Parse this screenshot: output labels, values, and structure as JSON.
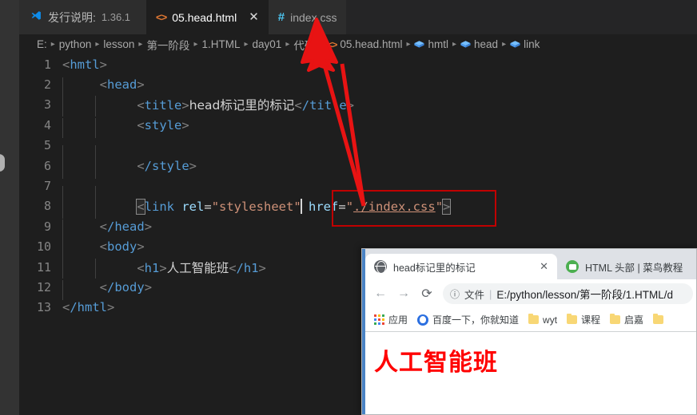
{
  "window": {
    "app": "Visual Studio Code",
    "tabs": [
      {
        "label": "发行说明:",
        "version": "1.36.1",
        "icon": "vscode-logo-icon",
        "state": "inactive",
        "closable": false
      },
      {
        "label": "05.head.html",
        "icon": "html-file-icon",
        "state": "active",
        "closable": true,
        "close_glyph": "✕"
      },
      {
        "label": "index.css",
        "icon": "css-file-icon",
        "state": "inactive",
        "closable": false
      }
    ]
  },
  "breadcrumb": {
    "separator": "▸",
    "items": [
      {
        "label": "E:",
        "icon": ""
      },
      {
        "label": "python",
        "icon": ""
      },
      {
        "label": "lesson",
        "icon": ""
      },
      {
        "label": "第一阶段",
        "icon": ""
      },
      {
        "label": "1.HTML",
        "icon": ""
      },
      {
        "label": "day01",
        "icon": ""
      },
      {
        "label": "代码",
        "icon": ""
      },
      {
        "label": "05.head.html",
        "icon": "html-file-icon"
      },
      {
        "label": "hmtl",
        "icon": "symbol-tag-icon"
      },
      {
        "label": "head",
        "icon": "symbol-tag-icon"
      },
      {
        "label": "link",
        "icon": "symbol-tag-icon"
      }
    ]
  },
  "editor": {
    "language": "html",
    "line_numbers": [
      1,
      2,
      3,
      4,
      5,
      6,
      7,
      8,
      9,
      10,
      11,
      12,
      13
    ],
    "lines": [
      {
        "n": 1,
        "text": "<hmtl>"
      },
      {
        "n": 2,
        "text": "    <head>"
      },
      {
        "n": 3,
        "text": "        <title>head标记里的标记</title>"
      },
      {
        "n": 4,
        "text": "        <style>"
      },
      {
        "n": 5,
        "text": ""
      },
      {
        "n": 6,
        "text": "        </style>"
      },
      {
        "n": 7,
        "text": ""
      },
      {
        "n": 8,
        "text": "        <link rel=\"stylesheet\" href=\"./index.css\">"
      },
      {
        "n": 9,
        "text": "    </head>"
      },
      {
        "n": 10,
        "text": "    <body>"
      },
      {
        "n": 11,
        "text": "        <h1>人工智能班</h1>"
      },
      {
        "n": 12,
        "text": "    </body>"
      },
      {
        "n": 13,
        "text": "</hmtl>"
      }
    ],
    "tokens": {
      "hmtl_open": "hmtl",
      "hmtl_close": "/hmtl",
      "head_open": "head",
      "head_close": "/head",
      "title_open": "title",
      "title_close": "/title",
      "title_text": "head标记里的标记",
      "style_open": "style",
      "style_close": "/style",
      "link_tag": "link",
      "attr_rel": "rel",
      "val_rel": "\"stylesheet\"",
      "attr_href": "href",
      "val_href_open": "\"",
      "val_href": "./index.css",
      "val_href_close": "\"",
      "body_open": "body",
      "body_close": "/body",
      "h1_open": "h1",
      "h1_close": "/h1",
      "h1_text": "人工智能班",
      "lt": "<",
      "gt": ">",
      "eq": "="
    },
    "colors": {
      "background": "#1e1e1e",
      "tag": "#569cd6",
      "attribute": "#9cdcfe",
      "string": "#ce9178",
      "plain": "#d4d4d4",
      "line_number": "#858585",
      "punctuation": "#808080"
    }
  },
  "annotation": {
    "type": "red-highlight-arrow",
    "color": "#c00000",
    "box_target": "href=\"./index.css\"",
    "arrow_points_to": "index.css"
  },
  "browser": {
    "tabs": [
      {
        "title": "head标记里的标记",
        "favicon": "globe-icon",
        "active": true,
        "close_glyph": "✕"
      },
      {
        "title": "HTML 头部 | 菜鸟教程",
        "favicon": "runoob-icon",
        "active": false
      }
    ],
    "toolbar": {
      "back_glyph": "←",
      "forward_glyph": "→",
      "reload_glyph": "⟳",
      "info_glyph": "ⓘ",
      "scheme_label": "文件",
      "separator": "|",
      "url": "E:/python/lesson/第一阶段/1.HTML/d"
    },
    "bookmarks": [
      {
        "label": "应用",
        "icon": "apps-grid-icon"
      },
      {
        "label": "百度一下，你就知道",
        "icon": "baidu-icon"
      },
      {
        "label": "wyt",
        "icon": "folder-icon"
      },
      {
        "label": "课程",
        "icon": "folder-icon"
      },
      {
        "label": "启嘉",
        "icon": "folder-icon"
      },
      {
        "label": "",
        "icon": "folder-icon"
      }
    ],
    "page": {
      "heading": "人工智能班",
      "heading_color": "#ff0000"
    }
  }
}
